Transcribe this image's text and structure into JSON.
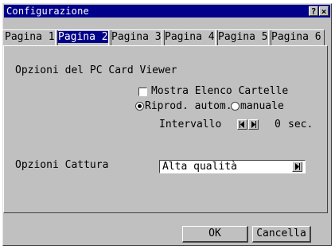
{
  "window": {
    "title": "Configurazione"
  },
  "titlebar_buttons": {
    "help": "?",
    "close": "×"
  },
  "tabs": [
    {
      "label": "Pagina 1",
      "active": false
    },
    {
      "label": "Pagina 2",
      "active": true
    },
    {
      "label": "Pagina 3",
      "active": false
    },
    {
      "label": "Pagina 4",
      "active": false
    },
    {
      "label": "Pagina 5",
      "active": false
    },
    {
      "label": "Pagina 6",
      "active": false
    }
  ],
  "pc_card_viewer": {
    "heading": "Opzioni del PC Card Viewer",
    "show_folder_list": {
      "label": "Mostra Elenco Cartelle",
      "checked": false
    },
    "play_mode": {
      "auto_label": "Riprod. autom.",
      "manual_label": "manuale",
      "selected": "auto"
    },
    "interval": {
      "label": "Intervallo",
      "value": "0",
      "unit": "sec."
    }
  },
  "capture": {
    "label": "Opzioni Cattura",
    "value": "Alta qualità"
  },
  "footer": {
    "ok_label": "OK",
    "cancel_label": "Cancella"
  },
  "colors": {
    "titlebar": "#00008b",
    "face": "#c0c0c0",
    "active_tab": "#00008b"
  }
}
